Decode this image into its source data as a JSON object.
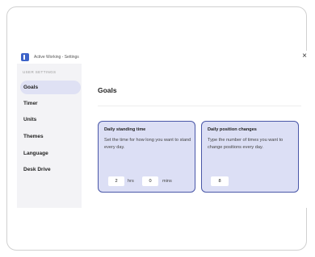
{
  "window": {
    "title": "Active Working - Settings",
    "close_glyph": "×"
  },
  "sidebar": {
    "section_label": "USER SETTINGS",
    "items": [
      {
        "label": "Goals",
        "active": true
      },
      {
        "label": "Timer"
      },
      {
        "label": "Units"
      },
      {
        "label": "Themes"
      },
      {
        "label": "Language"
      },
      {
        "label": "Desk Drive"
      }
    ]
  },
  "main": {
    "title": "Goals",
    "cards": [
      {
        "title": "Daily standing time",
        "description": "Set the time for how long you want to stand every day.",
        "hours_value": "2",
        "hours_unit": "hrs",
        "mins_value": "0",
        "mins_unit": "mins"
      },
      {
        "title": "Daily position changes",
        "description": "Type the number of times you want to change positions every day.",
        "value": "8"
      }
    ]
  },
  "colors": {
    "accent": "#4a57a8",
    "card_bg": "#dcdff5",
    "sidebar_bg": "#f3f3f6",
    "active_item_bg": "#dfe1f4"
  }
}
